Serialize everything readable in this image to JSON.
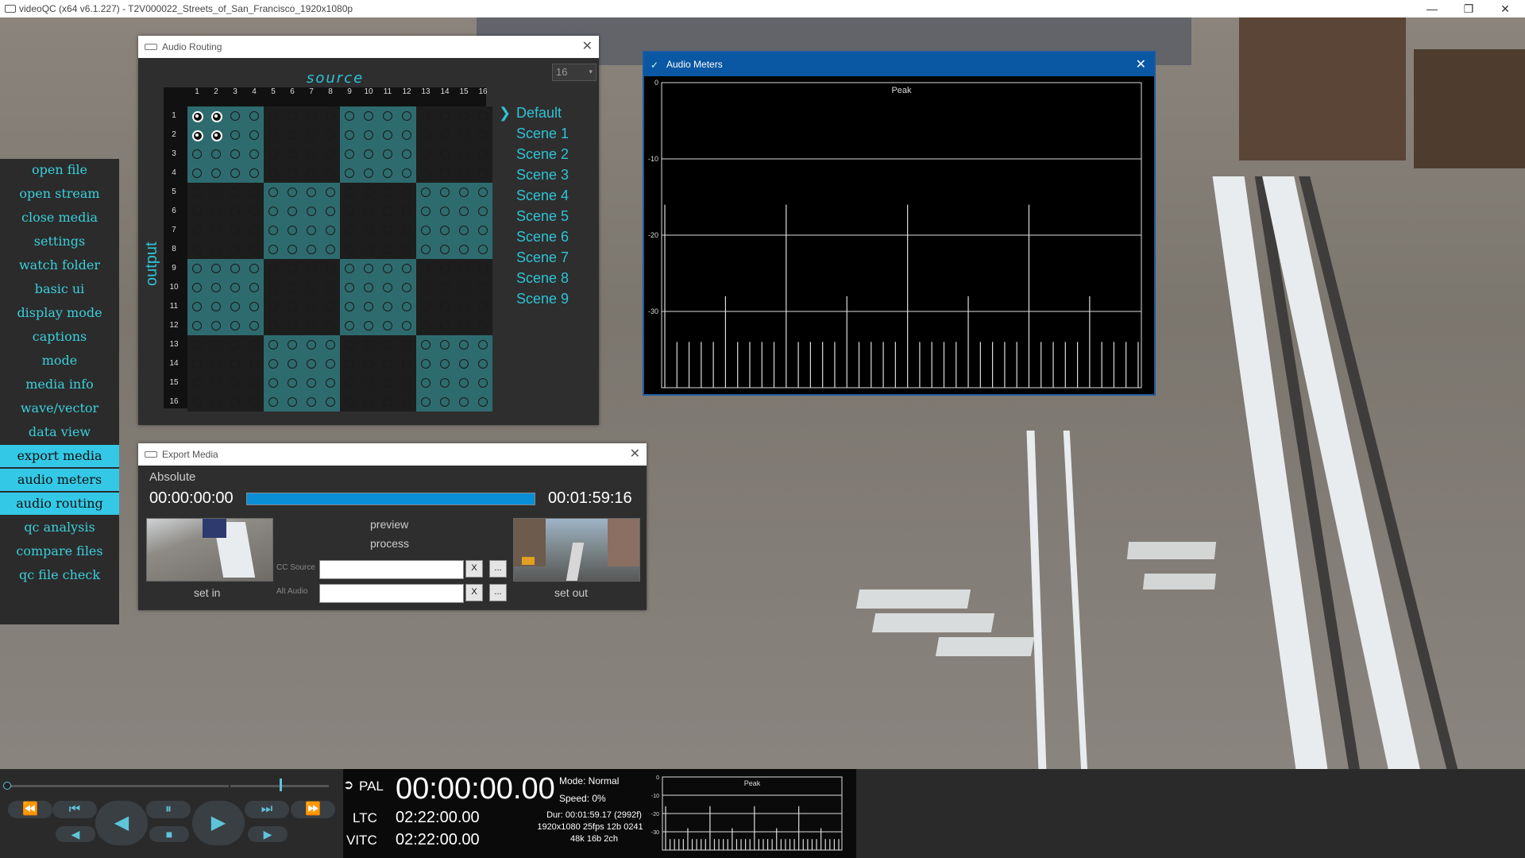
{
  "window": {
    "title": "videoQC (x64 v6.1.227) - T2V000022_Streets_of_San_Francisco_1920x1080p",
    "minimize": "—",
    "maximize": "❐",
    "close": "✕"
  },
  "sidebar": {
    "items": [
      {
        "label": "open file",
        "active": false
      },
      {
        "label": "open stream",
        "active": false
      },
      {
        "label": "close media",
        "active": false
      },
      {
        "label": "settings",
        "active": false
      },
      {
        "label": "watch folder",
        "active": false
      },
      {
        "label": "basic ui",
        "active": false
      },
      {
        "label": "display mode",
        "active": false
      },
      {
        "label": "captions",
        "active": false
      },
      {
        "label": "mode",
        "active": false
      },
      {
        "label": "media info",
        "active": false
      },
      {
        "label": "wave/vector",
        "active": false
      },
      {
        "label": "data view",
        "active": false
      },
      {
        "label": "export media",
        "active": true
      },
      {
        "label": "audio meters",
        "active": true
      },
      {
        "label": "audio routing",
        "active": true
      },
      {
        "label": "qc analysis",
        "active": false
      },
      {
        "label": "compare files",
        "active": false
      },
      {
        "label": "qc file check",
        "active": false
      }
    ]
  },
  "audio_routing": {
    "title": "Audio Routing",
    "close": "✕",
    "source_label": "source",
    "output_label": "output",
    "channel_count": "16",
    "dropdown_arrow": "▾",
    "columns": [
      "1",
      "2",
      "3",
      "4",
      "5",
      "6",
      "7",
      "8",
      "9",
      "10",
      "11",
      "12",
      "13",
      "14",
      "15",
      "16"
    ],
    "rows": [
      "1",
      "2",
      "3",
      "4",
      "5",
      "6",
      "7",
      "8",
      "9",
      "10",
      "11",
      "12",
      "13",
      "14",
      "15",
      "16"
    ],
    "routed": [
      [
        1,
        1
      ],
      [
        1,
        2
      ],
      [
        2,
        1
      ],
      [
        2,
        2
      ]
    ],
    "scenes": [
      "Default",
      "Scene 1",
      "Scene 2",
      "Scene 3",
      "Scene 4",
      "Scene 5",
      "Scene 6",
      "Scene 7",
      "Scene 8",
      "Scene 9"
    ],
    "selected_scene": "Default",
    "colors": {
      "teal": "#2e6b6e",
      "dark": "#1d1d1d",
      "accent": "#2ec3d6"
    }
  },
  "audio_meters": {
    "title": "Audio Meters",
    "close": "✕",
    "mode_label": "Peak",
    "scale": [
      "0",
      "-10",
      "-20",
      "-30"
    ],
    "tall_level_db": -16,
    "mid_level_db": -28,
    "low_level_db": -34
  },
  "export_media": {
    "title": "Export Media",
    "close": "✕",
    "mode": "Absolute",
    "in_tc": "00:00:00:00",
    "out_tc": "00:01:59:16",
    "progress_fraction": 1.0,
    "preview_label": "preview",
    "process_label": "process",
    "set_in_label": "set in",
    "set_out_label": "set out",
    "cc_source_label": "CC Source",
    "alt_audio_label": "Alt Audio",
    "cc_source_value": "",
    "alt_audio_value": "",
    "clear_label": "X",
    "browse_label": "..."
  },
  "transport": {
    "rewind": "⏪",
    "prev": "⏮",
    "back": "◀",
    "pause": "⏸",
    "play": "▶",
    "next": "⏭",
    "ffwd": "⏩",
    "step_back": "◀",
    "stop": "■",
    "step_fwd": "▶",
    "position_fraction": 0.0,
    "volume_fraction": 0.5
  },
  "timecode": {
    "standard": "PAL",
    "main": "00:00:00.00",
    "ltc_label": "LTC",
    "ltc": "02:22:00.00",
    "vitc_label": "VITC",
    "vitc": "02:22:00.00",
    "mode": "Mode: Normal",
    "speed": "Speed: 0%",
    "duration": "Dur: 00:01:59.17 (2992f)",
    "format": "1920x1080 25fps 12b 0241",
    "audio": "48k 16b 2ch",
    "mini_meter_label": "Peak",
    "mini_scale": [
      "0",
      "-10",
      "-20",
      "-30"
    ]
  }
}
